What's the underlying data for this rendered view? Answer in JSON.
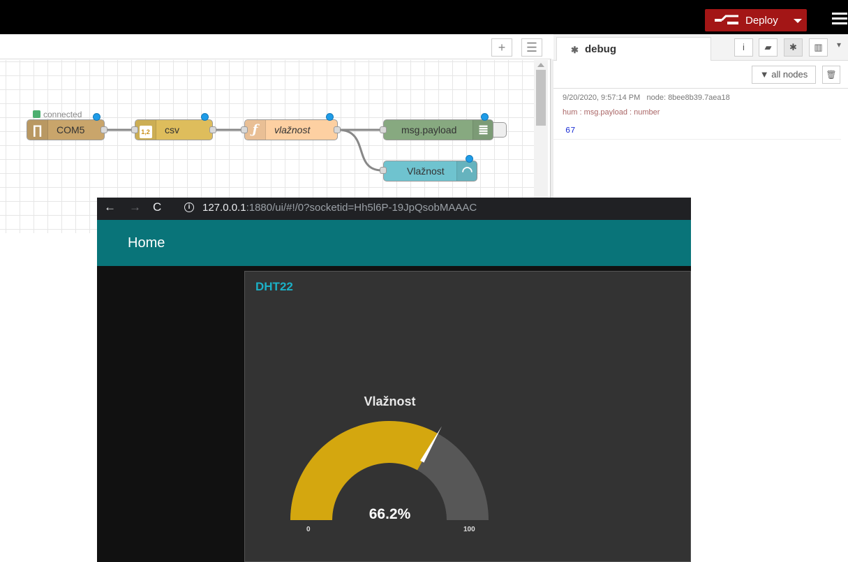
{
  "topbar": {
    "deploy_label": "Deploy",
    "accent": "#a31616"
  },
  "workspace": {
    "add_label": "+",
    "list_label": "☰"
  },
  "nodes": [
    {
      "id": "com5",
      "label": "COM5",
      "icon": "serial-icon",
      "color": "#c9a56b",
      "status": "connected"
    },
    {
      "id": "csv",
      "label": "csv",
      "icon": "csv-icon",
      "icon_text": "1,2",
      "color": "#debd5c"
    },
    {
      "id": "vlaznost-fn",
      "label": "vlažnost",
      "icon": "function-icon",
      "icon_text": "ƒ",
      "color": "#fdd0a2"
    },
    {
      "id": "msg-payload",
      "label": "msg.payload",
      "icon": "debug-list-icon",
      "color": "#87a980"
    },
    {
      "id": "vlaznost-gauge",
      "label": "Vlažnost",
      "icon": "gauge-icon",
      "color": "#6fc3cf"
    }
  ],
  "debug": {
    "tab_label": "debug",
    "filter_label": "all nodes",
    "message": {
      "timestamp": "9/20/2020, 9:57:14 PM",
      "node": "node: 8bee8b39.7aea18",
      "topic": "hum : msg.payload : number",
      "value": "67"
    }
  },
  "browser": {
    "url_host": "127.0.0.1",
    "url_rest": ":1880/ui/#!/0?socketid=Hh5l6P-19JpQsobMAAAC"
  },
  "dashboard": {
    "title": "Home",
    "group_title": "DHT22",
    "gauge": {
      "label": "Vlažnost",
      "value": 66.2,
      "value_text": "66.2%",
      "min": "0",
      "max": "100",
      "fill_color": "#d4a70f",
      "track_color": "#575757"
    },
    "header_color": "#097479"
  }
}
